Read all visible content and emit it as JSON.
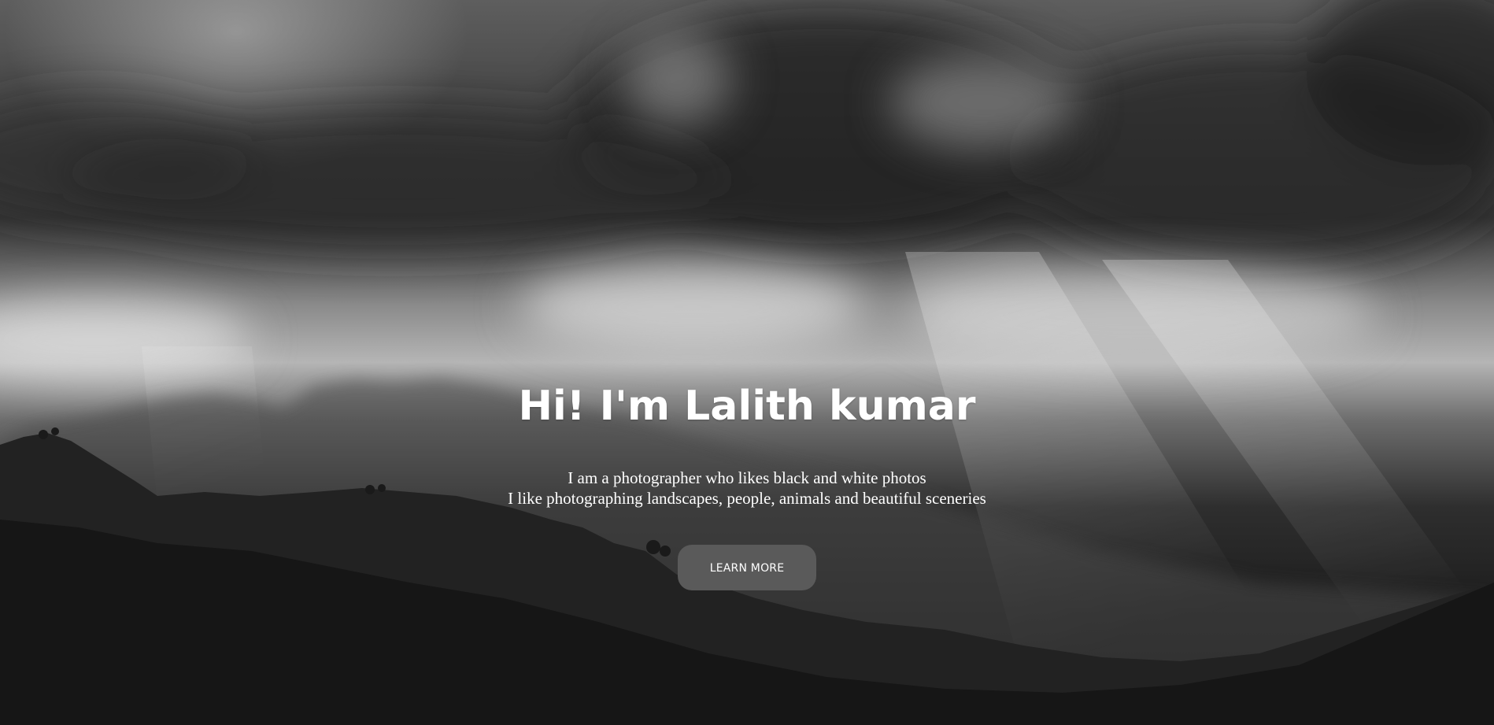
{
  "hero": {
    "title": "Hi! I'm Lalith kumar",
    "subtitle_lines": [
      "I am a photographer who likes black and white photos",
      "I like photographing landscapes, people, animals and beautiful sceneries"
    ],
    "cta_label": "LEARN MORE"
  },
  "colors": {
    "button_bg": "#5a5a5a",
    "text": "#ffffff",
    "background_dark": "#121212"
  }
}
